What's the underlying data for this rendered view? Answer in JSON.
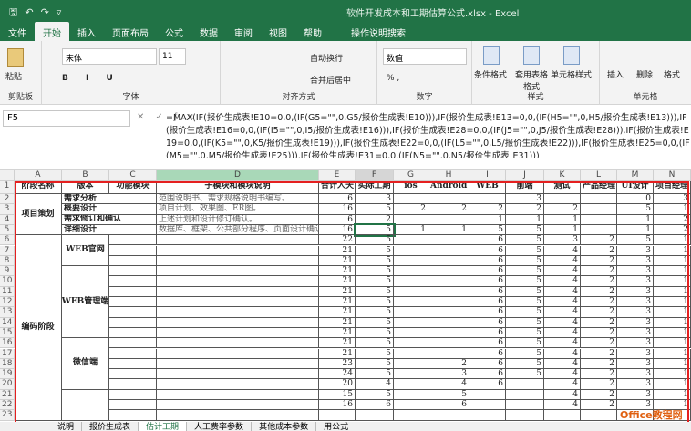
{
  "title": "软件开发成本和工期估算公式.xlsx  -  Excel",
  "tabs": [
    "文件",
    "开始",
    "插入",
    "页面布局",
    "公式",
    "数据",
    "审阅",
    "视图",
    "帮助",
    "操作说明搜索"
  ],
  "ribbon": {
    "paste": "粘贴",
    "clipboard": "剪贴板",
    "font_name": "宋体",
    "font_size": "11",
    "font": "字体",
    "wrap": "自动换行",
    "merge": "合并后居中",
    "align": "对齐方式",
    "numfmt": "数值",
    "number": "数字",
    "cond": "条件格式",
    "table": "套用表格格式",
    "cellstyle": "单元格样式",
    "styles": "样式",
    "insert": "插入",
    "delete": "删除",
    "format": "格式",
    "cells": "单元格"
  },
  "namebox": "F5",
  "formula": "=MAX(IF(报价生成表!E10=0,0,(IF(G5=\"\",0,G5/报价生成表!E10))),IF(报价生成表!E13=0,0,(IF(H5=\"\",0,H5/报价生成表!E13))),IF(报价生成表!E16=0,0,(IF(I5=\"\",0,I5/报价生成表!E16))),IF(报价生成表!E28=0,0,(IF(J5=\"\",0,J5/报价生成表!E28))),IF(报价生成表!E19=0,0,(IF(K5=\"\",0,K5/报价生成表!E19))),IF(报价生成表!E22=0,0,(IF(L5=\"\",0,L5/报价生成表!E22))),IF(报价生成表!E25=0,0,(IF(M5=\"\",0,M5/报价生成表!E25))),IF(报价生成表!E31=0,0,(IF(N5=\"\",0,N5/报价生成表!E31)))",
  "columns": [
    "A",
    "B",
    "C",
    "D",
    "E",
    "F",
    "G",
    "H",
    "I",
    "J",
    "K",
    "L",
    "M",
    "N"
  ],
  "headers": [
    "阶段名称",
    "版本",
    "功能模块",
    "子模块和模块说明",
    "合计人天",
    "实际工期",
    "ios",
    "Android",
    "WEB",
    "前端",
    "测试",
    "产品经理",
    "UI设计",
    "项目经理"
  ],
  "stages": {
    "plan": "项目策划",
    "code": "编码阶段"
  },
  "versions": {
    "r2": "需求分析",
    "r3": "概要设计",
    "r4": "需求修订和确认",
    "r5": "详细设计",
    "web": "WEB官网",
    "admin": "WEB管理端",
    "wechat": "微信端"
  },
  "desc": {
    "r2": "范围说明书、需求规格说明书编写。",
    "r3": "项目计划、效果图、ER图。",
    "r4": "上述计划和设计修订确认。",
    "r5": "数据库、框架、公共部分程序、页面设计确认"
  },
  "rows": [
    [
      "6",
      "3",
      "",
      "",
      "",
      "3",
      "",
      "",
      "0",
      "3"
    ],
    [
      "16",
      "5",
      "2",
      "2",
      "2",
      "2",
      "2",
      "",
      "5",
      "1"
    ],
    [
      "6",
      "2",
      "",
      "",
      "1",
      "1",
      "1",
      "",
      "1",
      "2"
    ],
    [
      "16",
      "5",
      "1",
      "1",
      "5",
      "5",
      "1",
      "",
      "1",
      "2"
    ],
    [
      "22",
      "5",
      "",
      "",
      "6",
      "5",
      "3",
      "2",
      "5",
      "1"
    ],
    [
      "21",
      "5",
      "",
      "",
      "6",
      "5",
      "4",
      "2",
      "3",
      "1"
    ],
    [
      "21",
      "5",
      "",
      "",
      "6",
      "5",
      "4",
      "2",
      "3",
      "1"
    ],
    [
      "21",
      "5",
      "",
      "",
      "6",
      "5",
      "4",
      "2",
      "3",
      "1"
    ],
    [
      "21",
      "5",
      "",
      "",
      "6",
      "5",
      "4",
      "2",
      "3",
      "1"
    ],
    [
      "21",
      "5",
      "",
      "",
      "6",
      "5",
      "4",
      "2",
      "3",
      "1"
    ],
    [
      "21",
      "5",
      "",
      "",
      "6",
      "5",
      "4",
      "2",
      "3",
      "1"
    ],
    [
      "21",
      "5",
      "",
      "",
      "6",
      "5",
      "4",
      "2",
      "3",
      "1"
    ],
    [
      "21",
      "5",
      "",
      "",
      "6",
      "5",
      "4",
      "2",
      "3",
      "1"
    ],
    [
      "21",
      "5",
      "",
      "",
      "6",
      "5",
      "4",
      "2",
      "3",
      "1"
    ],
    [
      "21",
      "5",
      "",
      "",
      "6",
      "5",
      "4",
      "2",
      "3",
      "1"
    ],
    [
      "21",
      "5",
      "",
      "",
      "6",
      "5",
      "4",
      "2",
      "3",
      "1"
    ],
    [
      "23",
      "5",
      "",
      "2",
      "6",
      "5",
      "4",
      "2",
      "3",
      "1"
    ],
    [
      "24",
      "5",
      "",
      "3",
      "6",
      "5",
      "4",
      "2",
      "3",
      "1"
    ],
    [
      "20",
      "4",
      "",
      "4",
      "6",
      "",
      "4",
      "2",
      "3",
      "1"
    ],
    [
      "15",
      "5",
      "",
      "5",
      "",
      "",
      "4",
      "2",
      "3",
      "1"
    ],
    [
      "16",
      "6",
      "",
      "6",
      "",
      "",
      "4",
      "2",
      "3",
      "1"
    ]
  ],
  "sheets": [
    "说明",
    "报价生成表",
    "估计工期",
    "人工费率参数",
    "其他成本参数",
    "用公式"
  ],
  "watermark": "Office教程网"
}
